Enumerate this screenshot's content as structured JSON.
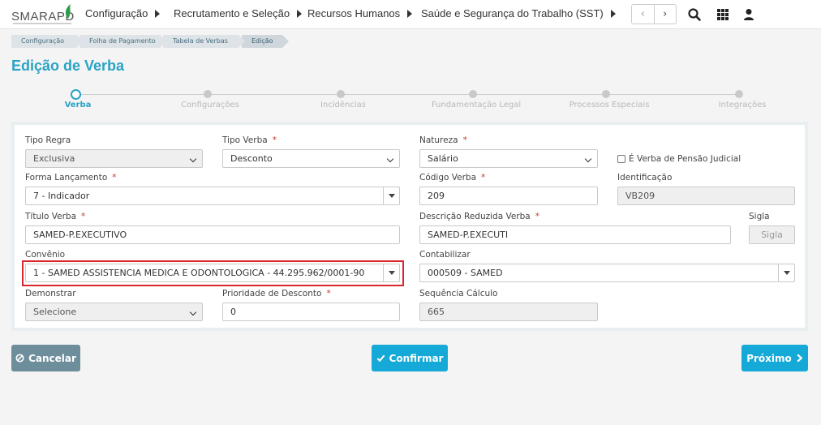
{
  "brand": {
    "logo_text": "SMARAPD"
  },
  "nav": {
    "items": [
      {
        "label": "Configuração"
      },
      {
        "label": "Recrutamento e Seleção"
      },
      {
        "label": "Recursos Humanos"
      },
      {
        "label": "Saúde e Segurança do Trabalho (SST)"
      }
    ],
    "pager_prev": "‹",
    "pager_next": "›",
    "icons": [
      "search-icon",
      "apps-grid-icon",
      "user-icon"
    ]
  },
  "breadcrumb": [
    {
      "label": "Configuração"
    },
    {
      "label": "Folha de Pagamento"
    },
    {
      "label": "Tabela de Verbas"
    },
    {
      "label": "Edição"
    }
  ],
  "page": {
    "title": "Edição de Verba"
  },
  "stepper": {
    "steps": [
      {
        "label": "Verba",
        "active": true
      },
      {
        "label": "Configurações",
        "active": false
      },
      {
        "label": "Incidências",
        "active": false
      },
      {
        "label": "Fundamentação Legal",
        "active": false
      },
      {
        "label": "Processos Especiais",
        "active": false
      },
      {
        "label": "Integrações",
        "active": false
      }
    ]
  },
  "form": {
    "tipo_regra": {
      "label": "Tipo Regra",
      "value": "Exclusiva"
    },
    "tipo_verba": {
      "label": "Tipo Verba",
      "required": "*",
      "value": "Desconto"
    },
    "natureza": {
      "label": "Natureza",
      "required": "*",
      "value": "Salário"
    },
    "pensao_judicial": {
      "label": "É Verba de Pensão Judicial",
      "checked": false
    },
    "forma_lancamento": {
      "label": "Forma Lançamento",
      "required": "*",
      "value": "7 - Indicador"
    },
    "codigo_verba": {
      "label": "Código Verba",
      "required": "*",
      "value": "209"
    },
    "identificacao": {
      "label": "Identificação",
      "value": "VB209"
    },
    "titulo_verba": {
      "label": "Título Verba",
      "required": "*",
      "value": "SAMED-P.EXECUTIVO"
    },
    "descricao_reduzida": {
      "label": "Descrição Reduzida Verba",
      "required": "*",
      "value": "SAMED-P.EXECUTI"
    },
    "sigla": {
      "label": "Sigla",
      "placeholder": "Sigla"
    },
    "convenio": {
      "label": "Convênio",
      "value": "1 - SAMED ASSISTENCIA MEDICA E ODONTOLOGICA - 44.295.962/0001-90"
    },
    "contabilizar": {
      "label": "Contabilizar",
      "value": "000509 - SAMED"
    },
    "demonstrar": {
      "label": "Demonstrar",
      "value": "Selecione"
    },
    "prioridade_desconto": {
      "label": "Prioridade de Desconto",
      "required": "*",
      "value": "0"
    },
    "sequencia_calculo": {
      "label": "Sequência Cálculo",
      "value": "665"
    }
  },
  "actions": {
    "cancel": "Cancelar",
    "confirm": "Confirmar",
    "next": "Próximo"
  },
  "colors": {
    "accent": "#2aa3c5",
    "primary_button": "#14a9d6",
    "cancel_button": "#6e8e9b",
    "highlight": "#d9262e"
  }
}
